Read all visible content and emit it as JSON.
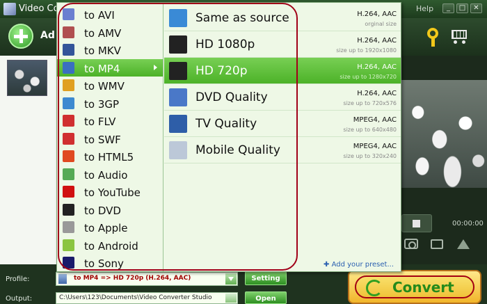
{
  "window": {
    "title": "Video Co",
    "help_label": "Help",
    "controls": [
      "_",
      "□",
      "✕"
    ]
  },
  "toolbar": {
    "add_label": "Ad",
    "icons": [
      "add-icon",
      "key-icon",
      "cart-icon"
    ]
  },
  "preview": {
    "time": "00:00:00"
  },
  "format_menu": {
    "selected": "to MP4",
    "items": [
      {
        "label": "to AVI",
        "icon": "avi-icon",
        "color": "#6a7fd0"
      },
      {
        "label": "to AMV",
        "icon": "amv-icon",
        "color": "#b05050"
      },
      {
        "label": "to MKV",
        "icon": "mkv-icon",
        "color": "#335599"
      },
      {
        "label": "to MP4",
        "icon": "mp4-icon",
        "color": "#3a6fc0"
      },
      {
        "label": "to WMV",
        "icon": "wmv-icon",
        "color": "#e0a020"
      },
      {
        "label": "to 3GP",
        "icon": "3gp-icon",
        "color": "#3d8ad0"
      },
      {
        "label": "to FLV",
        "icon": "flv-icon",
        "color": "#d03030"
      },
      {
        "label": "to SWF",
        "icon": "swf-icon",
        "color": "#d03030"
      },
      {
        "label": "to HTML5",
        "icon": "html5-icon",
        "color": "#e04a20"
      },
      {
        "label": "to Audio",
        "icon": "audio-icon",
        "color": "#55aa55"
      },
      {
        "label": "to YouTube",
        "icon": "youtube-icon",
        "color": "#d01010"
      },
      {
        "label": "to DVD",
        "icon": "dvd-icon",
        "color": "#222222"
      },
      {
        "label": "to Apple",
        "icon": "apple-icon",
        "color": "#999999"
      },
      {
        "label": "to Android",
        "icon": "android-icon",
        "color": "#8ac540"
      },
      {
        "label": "to Sony",
        "icon": "sony-icon",
        "color": "#1a1a6a"
      }
    ]
  },
  "preset_menu": {
    "selected": "HD 720p",
    "items": [
      {
        "label": "Same as source",
        "codec": "H.264, AAC",
        "size": "orginal size",
        "icon": "film-strip-icon",
        "color": "#3a8ad6"
      },
      {
        "label": "HD 1080p",
        "codec": "H.264, AAC",
        "size": "size up to 1920x1080",
        "icon": "hd-1080p-icon",
        "color": "#222222"
      },
      {
        "label": "HD 720p",
        "codec": "H.264, AAC",
        "size": "size up to 1280x720",
        "icon": "hd-720p-icon",
        "color": "#222222"
      },
      {
        "label": "DVD Quality",
        "codec": "H.264, AAC",
        "size": "size up to 720x576",
        "icon": "dvd-disc-icon",
        "color": "#4a78c8"
      },
      {
        "label": "TV Quality",
        "codec": "MPEG4, AAC",
        "size": "size up to 640x480",
        "icon": "tv-icon",
        "color": "#2e5ea8"
      },
      {
        "label": "Mobile Quality",
        "codec": "MPEG4, AAC",
        "size": "size up to 320x240",
        "icon": "mobile-icon",
        "color": "#bcc8d8"
      }
    ],
    "add_preset": "Add your preset..."
  },
  "bottom": {
    "profile_label": "Profile:",
    "profile_value": "to MP4 => HD 720p (H.264, AAC)",
    "setting_label": "Setting",
    "output_label": "Output:",
    "output_value": "C:\\Users\\123\\Documents\\Video Converter Studio",
    "open_label": "Open",
    "convert_label": "Convert"
  },
  "colors": {
    "menu_bg": "#eef8e6",
    "selection": "#5cbf36",
    "annotation_ring": "#a10018",
    "convert_bg": "#f4c640"
  }
}
